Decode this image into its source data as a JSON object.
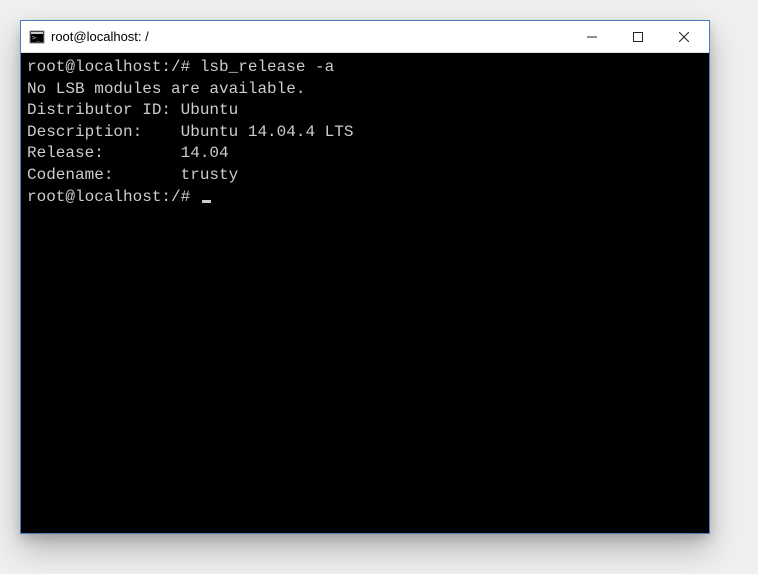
{
  "window": {
    "title": "root@localhost: /"
  },
  "terminal": {
    "prompt": "root@localhost:/#",
    "lines": [
      "root@localhost:/# lsb_release -a",
      "No LSB modules are available.",
      "Distributor ID: Ubuntu",
      "Description:    Ubuntu 14.04.4 LTS",
      "Release:        14.04",
      "Codename:       trusty",
      "root@localhost:/# "
    ]
  }
}
